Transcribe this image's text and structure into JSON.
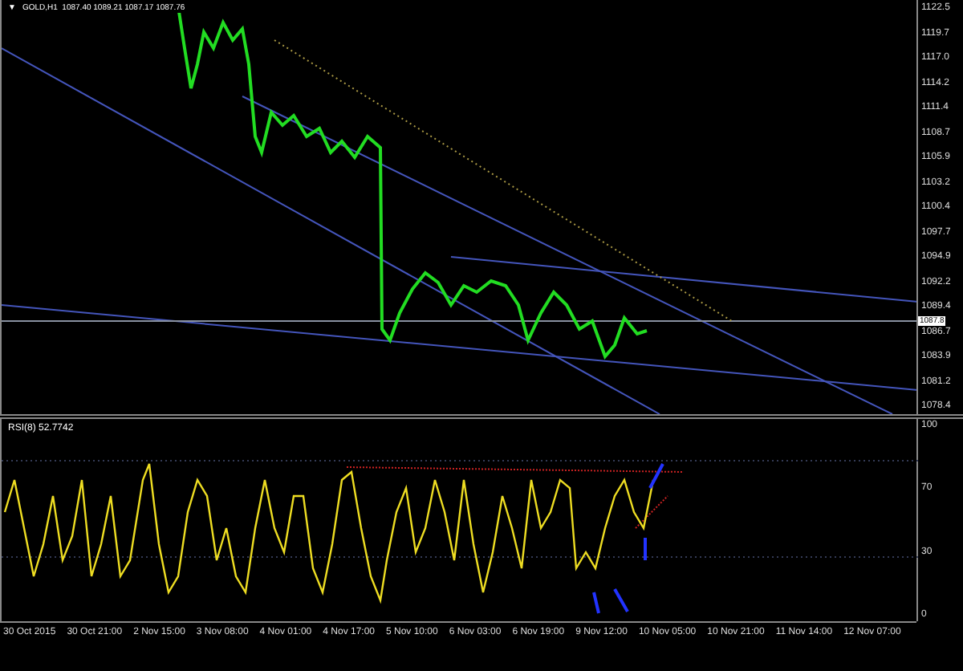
{
  "main_chart": {
    "menu_glyph": "▼",
    "header": "GOLD,H1  1087.40 1089.21 1087.17 1087.76",
    "current_price": "1087.8",
    "price_axis": [
      "1122.5",
      "1119.7",
      "1117.0",
      "1114.2",
      "1111.4",
      "1108.7",
      "1105.9",
      "1103.2",
      "1100.4",
      "1097.7",
      "1094.9",
      "1092.2",
      "1089.4",
      "1086.7",
      "1083.9",
      "1081.2",
      "1078.4"
    ]
  },
  "indicator": {
    "header": "RSI(8) 52.7742",
    "axis": [
      "100",
      "70",
      "30",
      "0"
    ]
  },
  "time_axis": [
    "30 Oct 2015",
    "30 Oct 21:00",
    "2 Nov 15:00",
    "3 Nov 08:00",
    "4 Nov 01:00",
    "4 Nov 17:00",
    "5 Nov 10:00",
    "6 Nov 03:00",
    "6 Nov 19:00",
    "9 Nov 12:00",
    "10 Nov 05:00",
    "10 Nov 21:00",
    "11 Nov 14:00",
    "12 Nov 07:00"
  ]
}
